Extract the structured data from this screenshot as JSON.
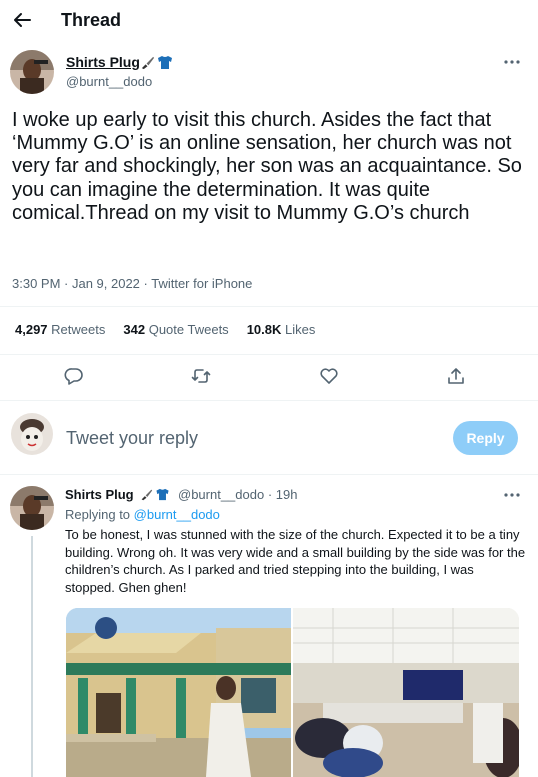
{
  "header": {
    "title": "Thread"
  },
  "tweet": {
    "author_name": "Shirts Plug",
    "author_handle": "@burnt__dodo",
    "text": "I woke up early to visit this church. Asides the fact that ‘Mummy G.O’ is an online sensation, her church was not very far and shockingly, her son was an acquaintance. So you can imagine the determination. It was quite comical.Thread on my visit to Mummy G.O’s church",
    "meta": "3:30 PM · Jan 9, 2022 · Twitter for iPhone",
    "retweets_count": "4,297",
    "retweets_label": "Retweets",
    "quotes_count": "342",
    "quotes_label": "Quote Tweets",
    "likes_count": "10.8K",
    "likes_label": "Likes"
  },
  "composer": {
    "placeholder": "Tweet your reply",
    "button_label": "Reply"
  },
  "reply": {
    "author_name": "Shirts Plug",
    "author_handle": "@burnt__dodo",
    "time": "19h",
    "replying_prefix": "Replying to",
    "replying_to": "@burnt__dodo",
    "text": "To be honest, I was stunned with the size of the church. Expected it to be a tiny building. Wrong oh. It was very wide and a small building by the side was for the children’s church. As I parked and tried stepping into the building, I was stopped. Ghen ghen!"
  },
  "icons": [
    "back-arrow-icon",
    "brush-icon",
    "tshirt-icon",
    "more-icon",
    "reply-icon",
    "retweet-icon",
    "like-icon",
    "share-icon"
  ],
  "colors": {
    "accent": "#1d9bf0",
    "reply_button": "#8ecdf8",
    "muted": "#536471"
  }
}
